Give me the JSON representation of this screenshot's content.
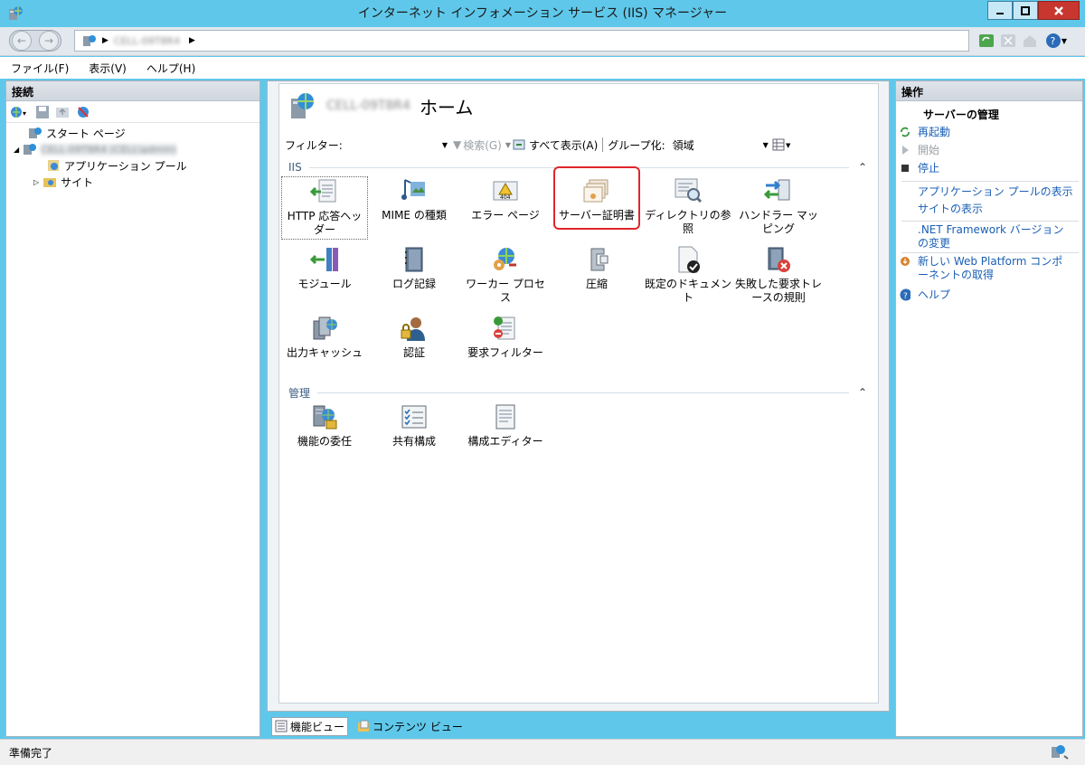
{
  "window": {
    "title": "インターネット インフォメーション サービス (IIS) マネージャー"
  },
  "address": {
    "path_text": "CELL-09T8R4"
  },
  "menu": [
    "ファイル(F)",
    "表示(V)",
    "ヘルプ(H)"
  ],
  "connections": {
    "title": "接続",
    "tree": {
      "start_page": "スタート ページ",
      "server": "CELL-09T8R4 (CELL\\admin)",
      "app_pools": "アプリケーション プール",
      "sites": "サイト"
    }
  },
  "home": {
    "server_name": "CELL-09T8R4",
    "title_suffix": "ホーム",
    "filter": {
      "label": "フィルター:",
      "search": "検索(G)",
      "show_all": "すべて表示(A)",
      "group_label": "グループ化:",
      "group_value": "領域"
    },
    "groups": [
      {
        "name": "IIS",
        "features": [
          "HTTP 応答ヘッダー",
          "MIME の種類",
          "エラー ページ",
          "サーバー証明書",
          "ディレクトリの参照",
          "ハンドラー マッピング",
          "モジュール",
          "ログ記録",
          "ワーカー プロセス",
          "圧縮",
          "既定のドキュメント",
          "失敗した要求トレースの規則",
          "出力キャッシュ",
          "認証",
          "要求フィルター"
        ]
      },
      {
        "name": "管理",
        "features": [
          "機能の委任",
          "共有構成",
          "構成エディター"
        ]
      }
    ],
    "view_tabs": {
      "features": "機能ビュー",
      "content": "コンテンツ ビュー"
    }
  },
  "actions": {
    "title": "操作",
    "section": "サーバーの管理",
    "items": {
      "restart": "再起動",
      "start": "開始",
      "stop": "停止",
      "view_app_pools": "アプリケーション プールの表示",
      "view_sites": "サイトの表示",
      "change_net": ".NET Framework バージョンの変更",
      "web_platform": "新しい Web Platform コンポーネントの取得",
      "help": "ヘルプ"
    }
  },
  "status": {
    "text": "準備完了"
  },
  "colors": {
    "titlebar": "#5fc8ea",
    "highlight": "#e0252b",
    "link": "#1a5fb4"
  }
}
